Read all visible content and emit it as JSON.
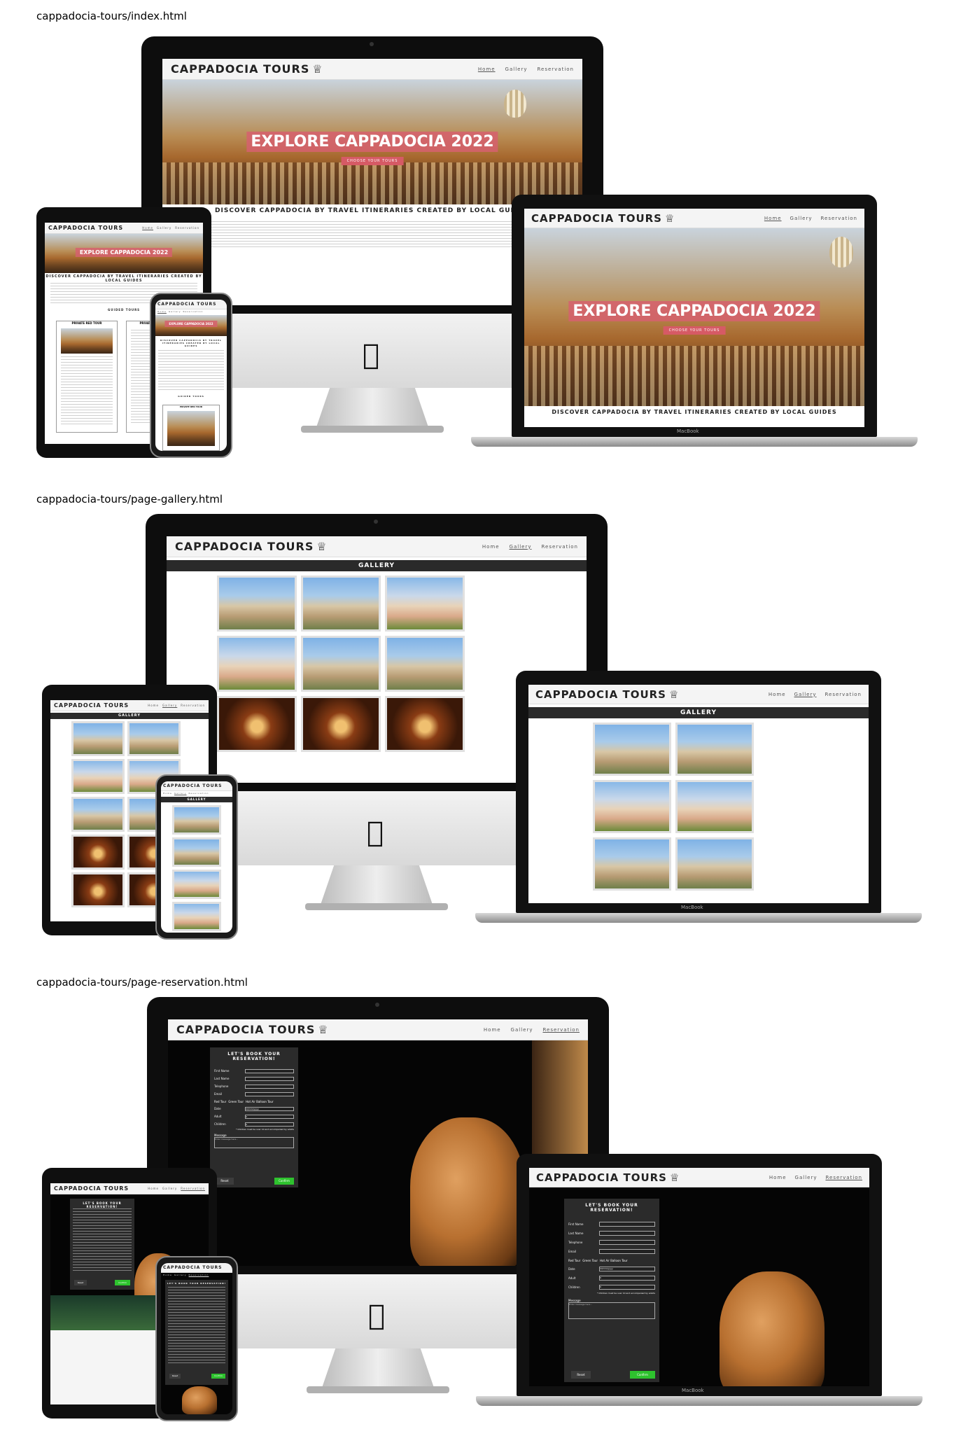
{
  "labels": {
    "index": "cappadocia-tours/index.html",
    "gallery": "cappadocia-tours/page-gallery.html",
    "reservation": "cappadocia-tours/page-reservation.html"
  },
  "site": {
    "brand": "CAPPADOCIA TOURS",
    "brand_icon": "camel-icon",
    "nav": {
      "home": "Home",
      "gallery": "Gallery",
      "reservation": "Reservation"
    }
  },
  "index": {
    "hero_title": "EXPLORE CAPPADOCIA 2022",
    "hero_button": "CHOOSE YOUR TOURS",
    "discover": "DISCOVER CAPPADOCIA BY TRAVEL ITINERARIES CREATED BY LOCAL GUIDES",
    "guided_tours": "GUIDED TOURS",
    "private_red_tour": "PRIVATE RED TOUR",
    "private_green_tour": "PRIVATE GREEN TOUR"
  },
  "gallery": {
    "title": "GALLERY"
  },
  "reservation": {
    "title": "LET'S BOOK YOUR RESERVATION!",
    "fields": [
      "First Name",
      "Last Name",
      "Telephone",
      "Email"
    ],
    "tours": [
      "Red Tour",
      "Green Tour",
      "Hot Air Balloon Tour"
    ],
    "date_label": "Date",
    "date_value": "dd/mm/yyyy",
    "adult_label": "Adult",
    "adult_value": "0",
    "children_label": "Children",
    "children_value": "0",
    "children_note": "* Children must be over 10 and accompanied by adults",
    "message_label": "Message",
    "message_placeholder": "Enter message here...",
    "reset": "Reset",
    "confirm": "Confirm"
  },
  "device": {
    "laptop_brand": "MacBook",
    "apple_logo": "apple-icon"
  },
  "colors": {
    "hero_pink": "#d65a65",
    "confirm_green": "#2ec22e",
    "form_panel": "#2b2b2b",
    "gallery_bar": "#2a2a2a"
  }
}
